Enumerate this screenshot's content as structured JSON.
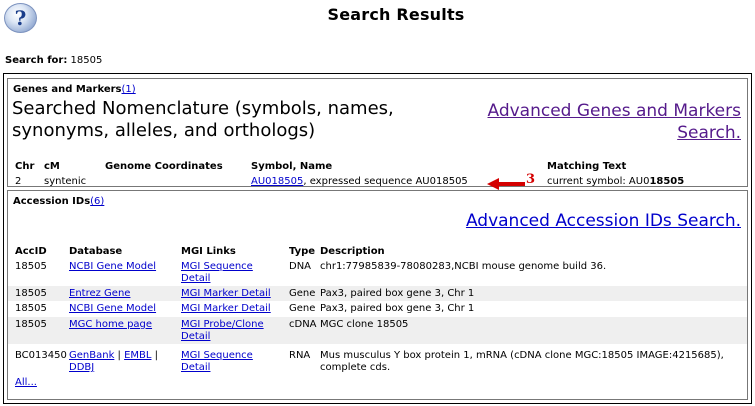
{
  "page": {
    "help_icon": "question-mark-icon",
    "title": "Search Results",
    "search_for_label": "Search for:",
    "search_for_value": "18505"
  },
  "genes_markers": {
    "heading": "Genes and Markers",
    "count_link": "(1)",
    "searched_desc": "Searched Nomenclature (symbols, names, synonyms, alleles, and orthologs)",
    "advanced_link": "Advanced Genes and Markers Search.",
    "columns": [
      "Chr",
      "cM",
      "Genome Coordinates",
      "Symbol, Name",
      "Matching Text"
    ],
    "row": {
      "chr": "2",
      "cm": "syntenic",
      "coords": "",
      "symbol": "AU018505",
      "name": ", expressed sequence AU018505",
      "matching_prefix": "current symbol: AU0",
      "matching_bold": "18505"
    }
  },
  "accession": {
    "heading": "Accession IDs",
    "count_link": "(6)",
    "advanced_link": "Advanced Accession IDs Search.",
    "columns": [
      "AccID",
      "Database",
      "MGI Links",
      "Type",
      "Description"
    ],
    "rows": [
      {
        "accid": "18505",
        "db": "NCBI Gene Model",
        "mgi_line1": "MGI Sequence",
        "mgi_line2": "Detail",
        "type": "DNA",
        "desc": "chr1:77985839-78080283,NCBI mouse genome build 36."
      },
      {
        "accid": "18505",
        "db": "Entrez Gene",
        "mgi_line1": "MGI Marker Detail",
        "type": "Gene",
        "desc": "Pax3, paired box gene 3, Chr 1"
      },
      {
        "accid": "18505",
        "db": "NCBI Gene Model",
        "mgi_line1": "MGI Marker Detail",
        "type": "Gene",
        "desc": "Pax3, paired box gene 3, Chr 1"
      },
      {
        "accid": "18505",
        "db": "MGC home page",
        "mgi_line1": "MGI Probe/Clone",
        "mgi_line2": "Detail",
        "type": "cDNA",
        "desc": "MGC clone 18505"
      },
      {
        "accid": "BC013450",
        "db_parts": [
          "GenBank",
          " | ",
          "EMBL",
          " | ",
          "DDBJ"
        ],
        "mgi_line1": "MGI Sequence",
        "mgi_line2": "Detail",
        "type": "RNA",
        "desc_line1": "Mus musculus Y box protein 1, mRNA (cDNA clone MGC:18505 IMAGE:4215685),",
        "desc_line2": "complete cds."
      }
    ],
    "all_link": "All..."
  },
  "annotation": {
    "arrow_color": "#d40000",
    "label": "3"
  }
}
